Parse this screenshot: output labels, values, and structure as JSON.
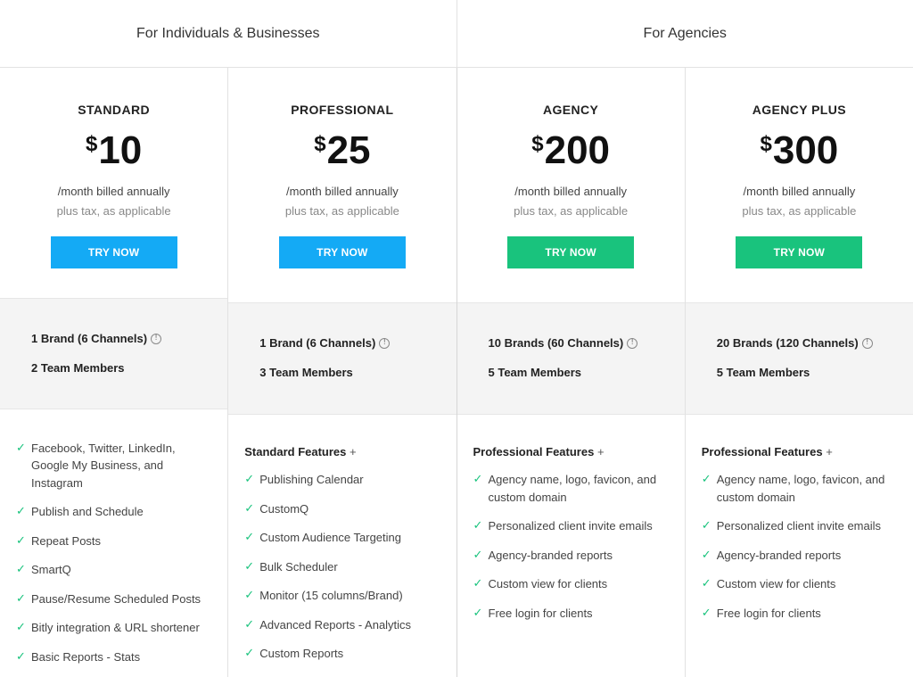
{
  "groups": {
    "individuals": "For Individuals & Businesses",
    "agencies": "For Agencies"
  },
  "colors": {
    "blue": "#14aaf5",
    "green": "#19c37d",
    "check": "#19c37d"
  },
  "plans": [
    {
      "name": "STANDARD",
      "currency": "$",
      "price": "10",
      "billed": "/month billed annually",
      "tax": "plus tax, as applicable",
      "cta": "TRY NOW",
      "brands": "1 Brand (6 Channels)",
      "team": "2 Team Members",
      "features_head": "",
      "features": [
        "Facebook, Twitter, LinkedIn, Google My Business, and Instagram",
        "Publish and Schedule",
        "Repeat Posts",
        "SmartQ",
        "Pause/Resume Scheduled Posts",
        "Bitly integration & URL shortener",
        "Basic Reports - Stats"
      ]
    },
    {
      "name": "PROFESSIONAL",
      "currency": "$",
      "price": "25",
      "billed": "/month billed annually",
      "tax": "plus tax, as applicable",
      "cta": "TRY NOW",
      "brands": "1 Brand (6 Channels)",
      "team": "3 Team Members",
      "features_head": "Standard Features",
      "features": [
        "Publishing Calendar",
        "CustomQ",
        "Custom Audience Targeting",
        "Bulk Scheduler",
        "Monitor (15 columns/Brand)",
        "Advanced Reports - Analytics",
        "Custom Reports"
      ]
    },
    {
      "name": "AGENCY",
      "currency": "$",
      "price": "200",
      "billed": "/month billed annually",
      "tax": "plus tax, as applicable",
      "cta": "TRY NOW",
      "brands": "10 Brands (60 Channels)",
      "team": "5 Team Members",
      "features_head": "Professional Features",
      "features": [
        "Agency name, logo, favicon, and custom domain",
        "Personalized client invite emails",
        "Agency-branded reports",
        "Custom view for clients",
        "Free login for clients"
      ]
    },
    {
      "name": "AGENCY PLUS",
      "currency": "$",
      "price": "300",
      "billed": "/month billed annually",
      "tax": "plus tax, as applicable",
      "cta": "TRY NOW",
      "brands": "20 Brands (120 Channels)",
      "team": "5 Team Members",
      "features_head": "Professional Features",
      "features": [
        "Agency name, logo, favicon, and custom domain",
        "Personalized client invite emails",
        "Agency-branded reports",
        "Custom view for clients",
        "Free login for clients"
      ]
    }
  ],
  "plus_sign": "+",
  "info_glyph": "!",
  "check_glyph": "✓"
}
